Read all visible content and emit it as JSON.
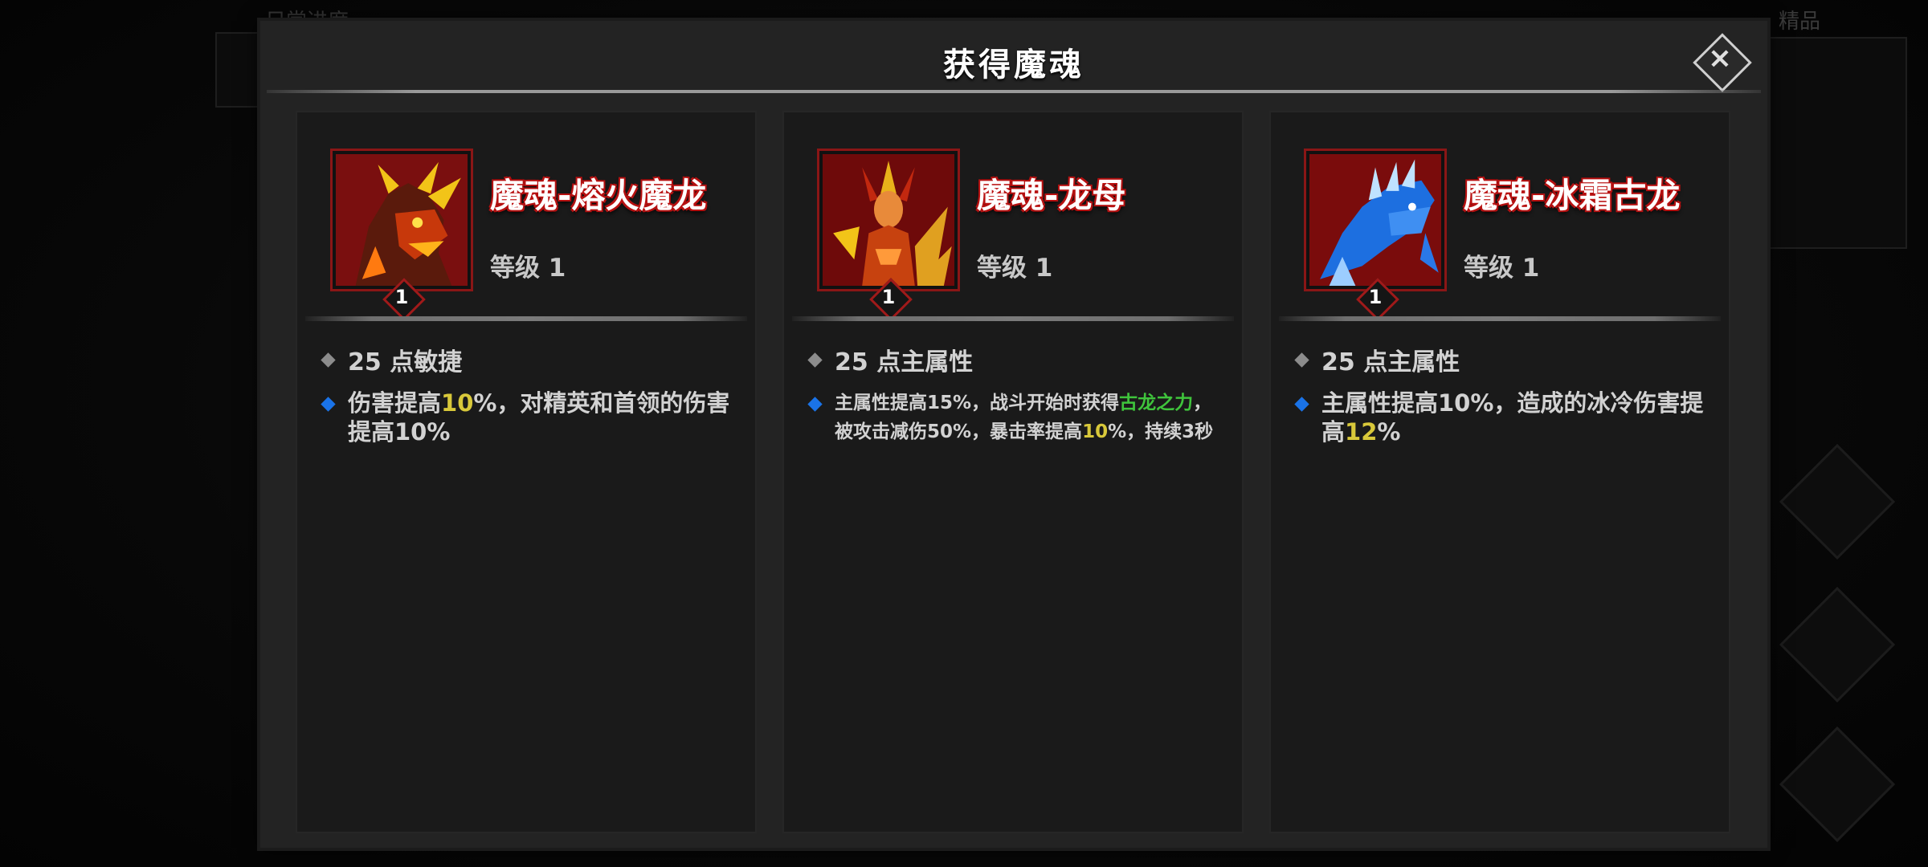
{
  "modal": {
    "title": "获得魔魂",
    "close_label": "×"
  },
  "background": {
    "top_left_text": "日常进度",
    "top_right_text": "精品"
  },
  "souls": [
    {
      "name": "魔魂-熔火魔龙",
      "level_text": "等级 1",
      "level_badge": "1",
      "stat": "25 点敏捷",
      "effect": {
        "part1": "伤害提高",
        "highlight1": "10",
        "part2": "%，对精英和首领的伤害提高10%",
        "highlight2": "",
        "part3": ""
      },
      "portrait_icon": "molten-dragon-portrait",
      "portrait_color": "#b31a0a"
    },
    {
      "name": "魔魂-龙母",
      "level_text": "等级 1",
      "level_badge": "1",
      "stat": "25 点主属性",
      "effect": {
        "part1": "主属性提高15%，战斗开始时获得",
        "highlight_green": "古龙之力",
        "part2": "，被攻击减伤50%，暴击率提高",
        "highlight1": "10",
        "part3": "%，持续3秒"
      },
      "portrait_icon": "dragon-mother-portrait",
      "portrait_color": "#8e1010"
    },
    {
      "name": "魔魂-冰霜古龙",
      "level_text": "等级 1",
      "level_badge": "1",
      "stat": "25 点主属性",
      "effect": {
        "part1": "主属性提高10%，造成的冰冷伤害提高",
        "highlight1": "12",
        "part2": "%",
        "highlight2": "",
        "part3": ""
      },
      "portrait_icon": "frost-dragon-portrait",
      "portrait_color": "#1e5fc4"
    }
  ],
  "colors": {
    "highlight_yellow": "#d8c83a",
    "highlight_green": "#3fc43c",
    "name_outline_red": "#b31212",
    "bullet_blue": "#1a73e8",
    "bullet_grey": "#8c8c8c"
  }
}
